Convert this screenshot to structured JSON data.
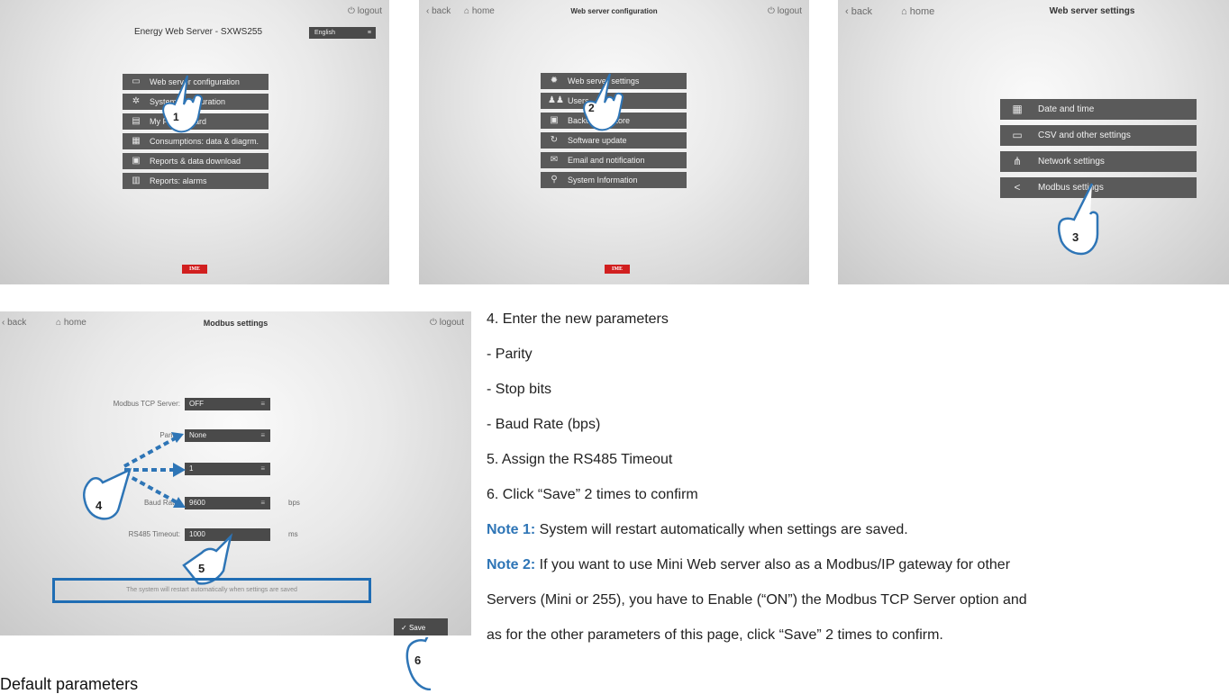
{
  "screen1": {
    "logout": "logout",
    "title": "Energy Web Server - SXWS255",
    "language": "English",
    "menu": [
      {
        "icon": "monitor-icon",
        "label": "Web server configuration"
      },
      {
        "icon": "gears-icon",
        "label": "System configuration"
      },
      {
        "icon": "board-icon",
        "label": "My Panel board"
      },
      {
        "icon": "chart-icon",
        "label": "Consumptions: data & diagrm."
      },
      {
        "icon": "report-icon",
        "label": "Reports & data download"
      },
      {
        "icon": "alarm-report-icon",
        "label": "Reports: alarms"
      }
    ],
    "logo": "IME",
    "step": "1"
  },
  "screen2": {
    "back": "back",
    "home": "home",
    "title": "Web server configuration",
    "logout": "logout",
    "menu": [
      {
        "icon": "gear-icon",
        "label": "Web server settings"
      },
      {
        "icon": "users-icon",
        "label": "Users"
      },
      {
        "icon": "backup-icon",
        "label": "Backup / Restore"
      },
      {
        "icon": "update-icon",
        "label": "Software update"
      },
      {
        "icon": "email-icon",
        "label": "Email and notification"
      },
      {
        "icon": "search-icon",
        "label": "System Information"
      }
    ],
    "logo": "IME",
    "step": "2"
  },
  "screen3": {
    "back": "back",
    "home": "home",
    "title": "Web server settings",
    "menu": [
      {
        "icon": "calendar-clock-icon",
        "label": "Date and time"
      },
      {
        "icon": "monitor-icon",
        "label": "CSV and other settings"
      },
      {
        "icon": "network-icon",
        "label": "Network settings"
      },
      {
        "icon": "share-icon",
        "label": "Modbus settings"
      }
    ],
    "step": "3"
  },
  "screen4": {
    "back": "back",
    "home": "home",
    "title": "Modbus settings",
    "logout": "logout",
    "fields": [
      {
        "label": "Modbus TCP Server:",
        "value": "OFF",
        "unit": ""
      },
      {
        "label": "Parity:",
        "value": "None",
        "unit": ""
      },
      {
        "label": "",
        "value": "1",
        "unit": ""
      },
      {
        "label": "Baud Rate:",
        "value": "9600",
        "unit": "bps"
      },
      {
        "label": "RS485 Timeout:",
        "value": "1000",
        "unit": "ms"
      }
    ],
    "restart_message": "The system will restart automatically when settings are saved",
    "save": "Save",
    "steps": [
      "4",
      "5",
      "6"
    ]
  },
  "instructions": {
    "line1": "4. Enter the new parameters",
    "line2": "- Parity",
    "line3": "- Stop bits",
    "line4": "- Baud Rate (bps)",
    "line5": "5. Assign the RS485 Timeout",
    "line6": "6. Click “Save” 2 times to confirm",
    "note1_label": "Note 1:",
    "note1_text": " System will restart automatically when settings are saved.",
    "note2_label": "Note 2:",
    "note2_line1": " If you want to use Mini Web server also as a Modbus/IP gateway for other",
    "note2_line2": "Servers (Mini or 255), you have to Enable (“ON”) the Modbus TCP Server option and",
    "note2_line3": "as for the other parameters of this page, click “Save” 2 times to confirm."
  },
  "footer_heading": "Default parameters"
}
